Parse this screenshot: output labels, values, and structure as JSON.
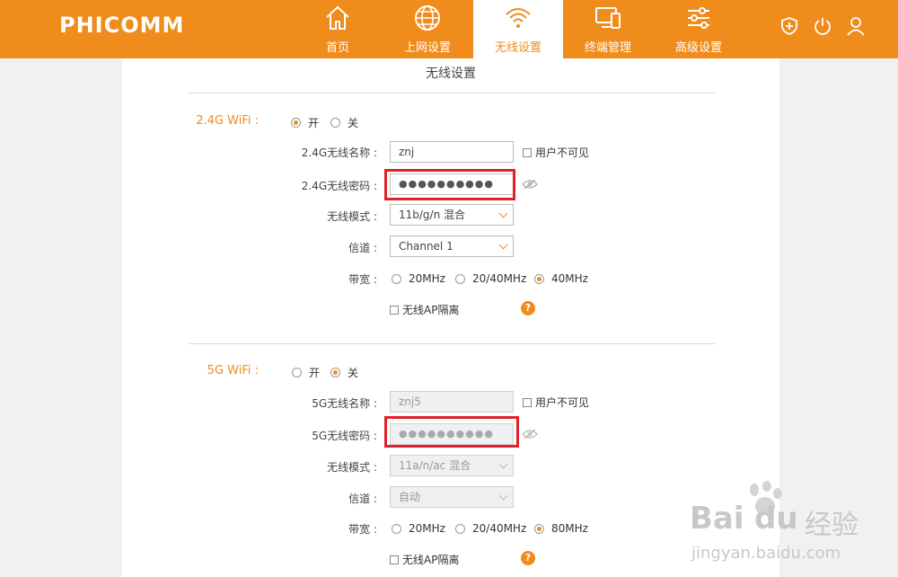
{
  "header": {
    "logo": "PHICOMM",
    "nav": [
      {
        "label": "首页",
        "icon": "home-icon"
      },
      {
        "label": "上网设置",
        "icon": "globe-icon"
      },
      {
        "label": "无线设置",
        "icon": "wifi-icon",
        "active": true
      },
      {
        "label": "终端管理",
        "icon": "devices-icon"
      },
      {
        "label": "高级设置",
        "icon": "sliders-icon"
      }
    ],
    "right_icons": [
      "shield-icon",
      "power-icon",
      "user-icon"
    ],
    "accent": "#f08c1c"
  },
  "page_title": "无线设置",
  "wifi24": {
    "label": "2.4G WiFi :",
    "on_label": "开",
    "off_label": "关",
    "enabled": true,
    "name_label": "2.4G无线名称 :",
    "name_value": "znj",
    "hide_label": "用户不可见",
    "pw_label": "2.4G无线密码 :",
    "pw_value": "●●●●●●●●●●",
    "mode_label": "无线模式 :",
    "mode_value": "11b/g/n 混合",
    "channel_label": "信道 :",
    "channel_value": "Channel 1",
    "bw_label": "带宽 :",
    "bw_options": [
      "20MHz",
      "20/40MHz",
      "40MHz"
    ],
    "bw_selected": "40MHz",
    "isolation_label": "无线AP隔离",
    "help": "?"
  },
  "wifi5": {
    "label": "5G WiFi :",
    "on_label": "开",
    "off_label": "关",
    "enabled": false,
    "name_label": "5G无线名称 :",
    "name_value": "znj5",
    "hide_label": "用户不可见",
    "pw_label": "5G无线密码 :",
    "pw_value": "●●●●●●●●●●",
    "mode_label": "无线模式 :",
    "mode_value": "11a/n/ac 混合",
    "channel_label": "信道 :",
    "channel_value": "自动",
    "bw_label": "带宽 :",
    "bw_options": [
      "20MHz",
      "20/40MHz",
      "80MHz"
    ],
    "bw_selected": "80MHz",
    "isolation_label": "无线AP隔离",
    "help": "?"
  },
  "watermark": {
    "brand": "Bai",
    "brand2": "du",
    "cn": "经验",
    "url": "jingyan.baidu.com"
  }
}
